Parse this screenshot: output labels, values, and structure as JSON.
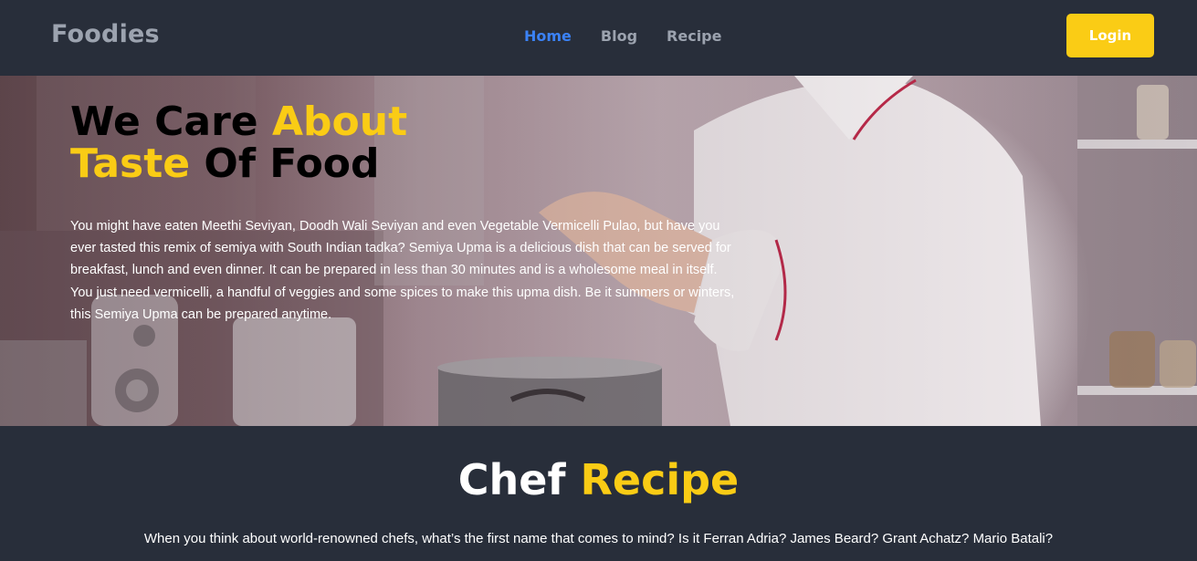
{
  "navbar": {
    "brand": "Foodies",
    "links": [
      {
        "label": "Home",
        "active": true
      },
      {
        "label": "Blog",
        "active": false
      },
      {
        "label": "Recipe",
        "active": false
      }
    ],
    "login_label": "Login"
  },
  "hero": {
    "title_part1": "We Care ",
    "title_part2": "About",
    "title_part3": "Taste",
    "title_part4": " Of Food",
    "description": "You might have eaten Meethi Seviyan, Doodh Wali Seviyan and even Vegetable Vermicelli Pulao, but have you ever tasted this remix of semiya with South Indian tadka? Semiya Upma is a delicious dish that can be served for breakfast, lunch and even dinner. It can be prepared in less than 30 minutes and is a wholesome meal in itself. You just need vermicelli, a handful of veggies and some spices to make this upma dish. Be it summers or winters, this Semiya Upma can be prepared anytime."
  },
  "chef_section": {
    "title_white": "Chef ",
    "title_yellow": "Recipe",
    "text": "When you think about world-renowned chefs, what’s the first name that comes to mind? Is it Ferran Adria? James Beard? Grant Achatz? Mario Batali?"
  },
  "colors": {
    "background": "#282e3a",
    "accent_yellow": "#facc15",
    "active_link": "#3b82f6",
    "muted_text": "#9ca3af"
  }
}
